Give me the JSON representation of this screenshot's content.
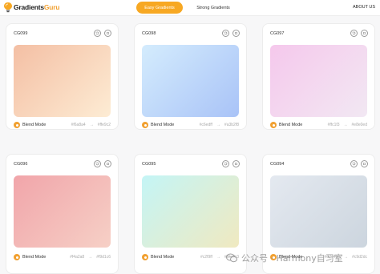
{
  "header": {
    "logo_part1": "Gradients",
    "logo_part2": "Guru",
    "tab_easy": "Easy Gradients",
    "tab_strong": "Strong Gradients",
    "about": "ABOUT US"
  },
  "common": {
    "blend_label": "Blend Mode",
    "arrow": "→"
  },
  "cards": [
    {
      "code": "CG099",
      "from": "#f6a8a4",
      "to": "#ffe9c2",
      "colors": [
        "#f4bfa4",
        "#fdecd4"
      ]
    },
    {
      "code": "CG098",
      "from": "#c6edff",
      "to": "#a3b2f8",
      "colors": [
        "#d4ecfd",
        "#a9c3f7"
      ]
    },
    {
      "code": "CG097",
      "from": "#ffc1f3",
      "to": "#e8e0ed",
      "colors": [
        "#f5c8ec",
        "#f2e8f3"
      ]
    },
    {
      "code": "CG096",
      "from": "#f4a2a8",
      "to": "#f9d1c6",
      "colors": [
        "#f1a5aa",
        "#f6d0c6"
      ]
    },
    {
      "code": "CG095",
      "from": "#c2f9ff",
      "to": "#f0e6b3",
      "colors": [
        "#c4f5f6",
        "#f0e9c0"
      ]
    },
    {
      "code": "CG094",
      "from": "#dde4ee",
      "to": "#c9d2dc",
      "colors": [
        "#e4e9f0",
        "#ccd5de"
      ]
    }
  ],
  "watermark": "公众号 · Harmony自习室"
}
